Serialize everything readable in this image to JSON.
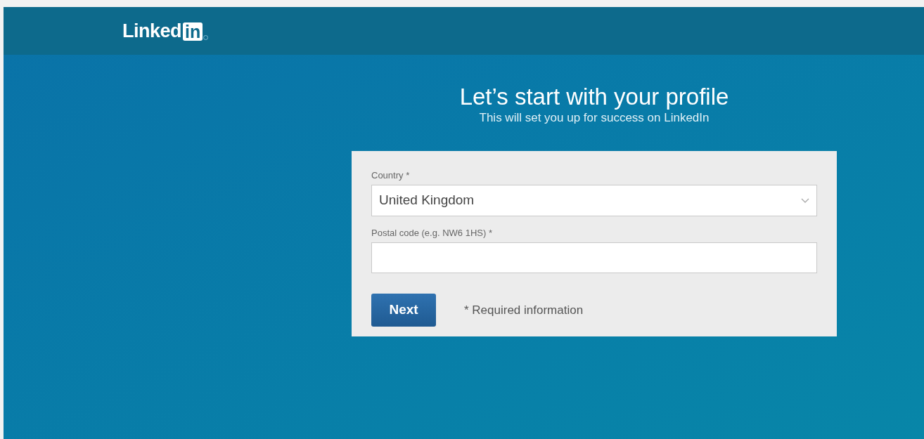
{
  "header": {
    "logo": {
      "word": "Linked",
      "badge": "in"
    }
  },
  "heading": {
    "title": "Let’s start with your profile",
    "subtitle": "This will set you up for success on LinkedIn"
  },
  "form": {
    "fields": [
      {
        "kind": "select",
        "label": "Country",
        "required_mark": "*",
        "value": "United Kingdom"
      },
      {
        "kind": "text",
        "label": "Postal code (e.g. NW6 1HS)",
        "required_mark": "*"
      }
    ],
    "submit": "Next",
    "note": "* Required information"
  }
}
